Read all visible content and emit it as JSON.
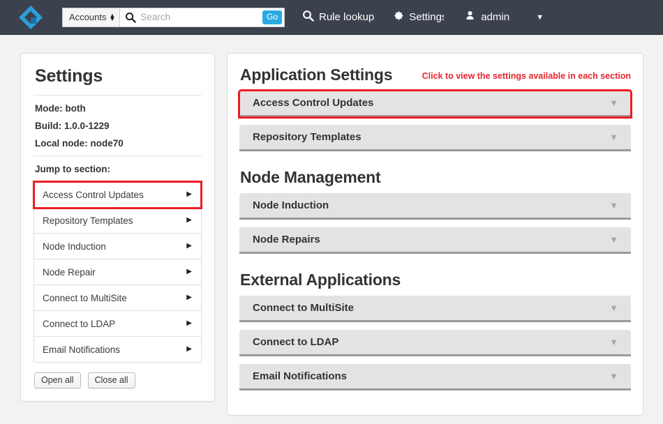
{
  "topbar": {
    "logo_icon": "diamond-logo-icon",
    "logo_colors": {
      "outer": "#2b9fd9",
      "inner": "#1f6fa8",
      "accent": "#3fb7ea"
    },
    "search": {
      "scope_label": "Accounts",
      "scope_icon": "updown-arrows-icon",
      "search_icon": "search-icon",
      "placeholder": "Search",
      "value": "",
      "go_label": "Go",
      "go_color": "#29abe2"
    },
    "rule_lookup": {
      "label": "Rule lookup",
      "icon": "search-icon"
    },
    "settings": {
      "label": "Settings",
      "icon": "gear-icon"
    },
    "user": {
      "label": "admin",
      "icon": "user-icon"
    },
    "caret": "▼",
    "background": "#3b414d"
  },
  "sidebar": {
    "title": "Settings",
    "meta": [
      "Mode: both",
      "Build: 1.0.0-1229",
      "Local node: node70"
    ],
    "jump_label": "Jump to section:",
    "items": [
      {
        "label": "Access Control Updates",
        "highlighted": true
      },
      {
        "label": "Repository Templates",
        "highlighted": false
      },
      {
        "label": "Node Induction",
        "highlighted": false
      },
      {
        "label": "Node Repair",
        "highlighted": false
      },
      {
        "label": "Connect to MultiSite",
        "highlighted": false
      },
      {
        "label": "Connect to LDAP",
        "highlighted": false
      },
      {
        "label": "Email Notifications",
        "highlighted": false
      }
    ],
    "arrow_glyph": "▶",
    "open_all_label": "Open all",
    "close_all_label": "Close all"
  },
  "main": {
    "annotation": "Click to view the settings available in each section",
    "annotation_color": "#e8262d",
    "highlight_color": "#ee1b24",
    "caret_glyph": "▼",
    "sections": [
      {
        "heading": "Application Settings",
        "items": [
          {
            "label": "Access Control Updates",
            "highlighted": true
          },
          {
            "label": "Repository Templates",
            "highlighted": false
          }
        ]
      },
      {
        "heading": "Node Management",
        "items": [
          {
            "label": "Node Induction",
            "highlighted": false
          },
          {
            "label": "Node Repairs",
            "highlighted": false
          }
        ]
      },
      {
        "heading": "External Applications",
        "items": [
          {
            "label": "Connect to MultiSite",
            "highlighted": false
          },
          {
            "label": "Connect to LDAP",
            "highlighted": false
          },
          {
            "label": "Email Notifications",
            "highlighted": false
          }
        ]
      }
    ]
  }
}
